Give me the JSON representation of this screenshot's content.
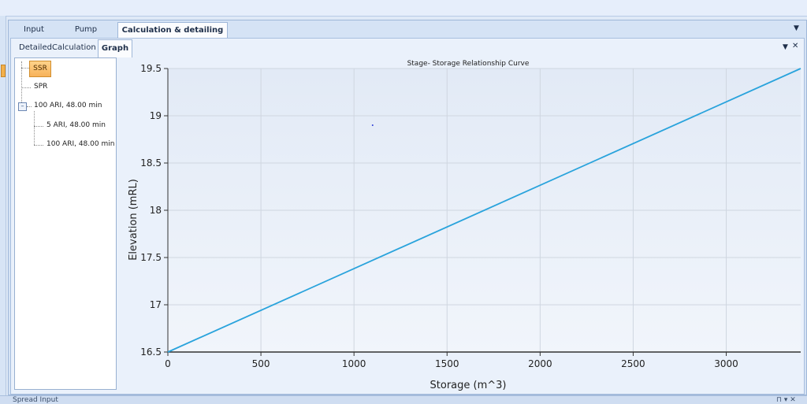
{
  "outer_tabs": [
    "Input",
    "Pump",
    "Calculation & detailing"
  ],
  "inner_tabs": [
    "DetailedCalculation",
    "Graph"
  ],
  "tree": {
    "root1": "SSR",
    "root2": "SPR",
    "group": "100 ARI, 48.00 min",
    "group_expander": "–",
    "children": [
      "5 ARI, 48.00 min",
      "100 ARI, 48.00 min"
    ]
  },
  "bottom_panel_title": "Spread Input",
  "bottom_icons": "⊓ ▾ ✕",
  "chart_data": {
    "type": "line",
    "title": "Stage- Storage Relationship Curve",
    "xlabel": "Storage (m^3)",
    "ylabel": "Elevation (mRL)",
    "xlim": [
      0,
      3400
    ],
    "ylim": [
      16.5,
      19.5
    ],
    "xticks": [
      0,
      500,
      1000,
      1500,
      2000,
      2500,
      3000
    ],
    "yticks": [
      16.5,
      17,
      17.5,
      18,
      18.5,
      19,
      19.5
    ],
    "xtick_labels": [
      "0",
      "500",
      "1000",
      "1500",
      "2000",
      "2500",
      "3000"
    ],
    "ytick_labels": [
      "16.5",
      "17",
      "17.5",
      "18",
      "18.5",
      "19",
      "19.5"
    ],
    "grid": true,
    "series": [
      {
        "color": "#29a3dc",
        "x": [
          0,
          3400
        ],
        "y": [
          16.5,
          19.5
        ]
      }
    ],
    "marker_point": {
      "x": 1100,
      "y": 18.9,
      "color": "#2a3bd6"
    }
  }
}
